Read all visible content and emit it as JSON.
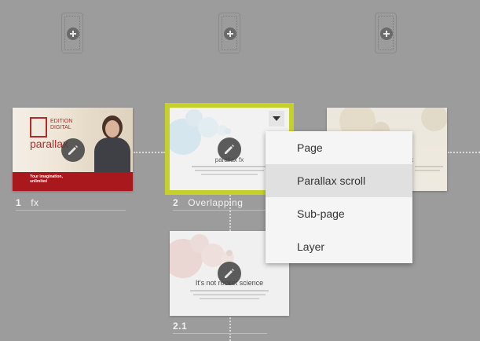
{
  "add_slots": [
    {
      "label": "add-page-slot-1"
    },
    {
      "label": "add-page-slot-2"
    },
    {
      "label": "add-page-slot-3"
    }
  ],
  "cards": [
    {
      "number": "1",
      "name": "fx",
      "brand_line1": "EDITION",
      "brand_line2": "DIGITAL",
      "product": "parallax",
      "tagline_1": "Your imagination,",
      "tagline_2": "unlimited"
    },
    {
      "number": "2",
      "name": "Overlapping",
      "title": "parallax fx",
      "accent_color": "#c5d12a"
    },
    {
      "number": "",
      "name": "",
      "title": "fx"
    },
    {
      "number": "2.1",
      "name": "",
      "title": "It's not rocket science"
    }
  ],
  "dropdown_icon": "triangle-down-icon",
  "edit_icon": "pencil-icon",
  "menu": {
    "items": [
      "Page",
      "Parallax scroll",
      "Sub-page",
      "Layer"
    ],
    "selected": "Parallax scroll"
  }
}
